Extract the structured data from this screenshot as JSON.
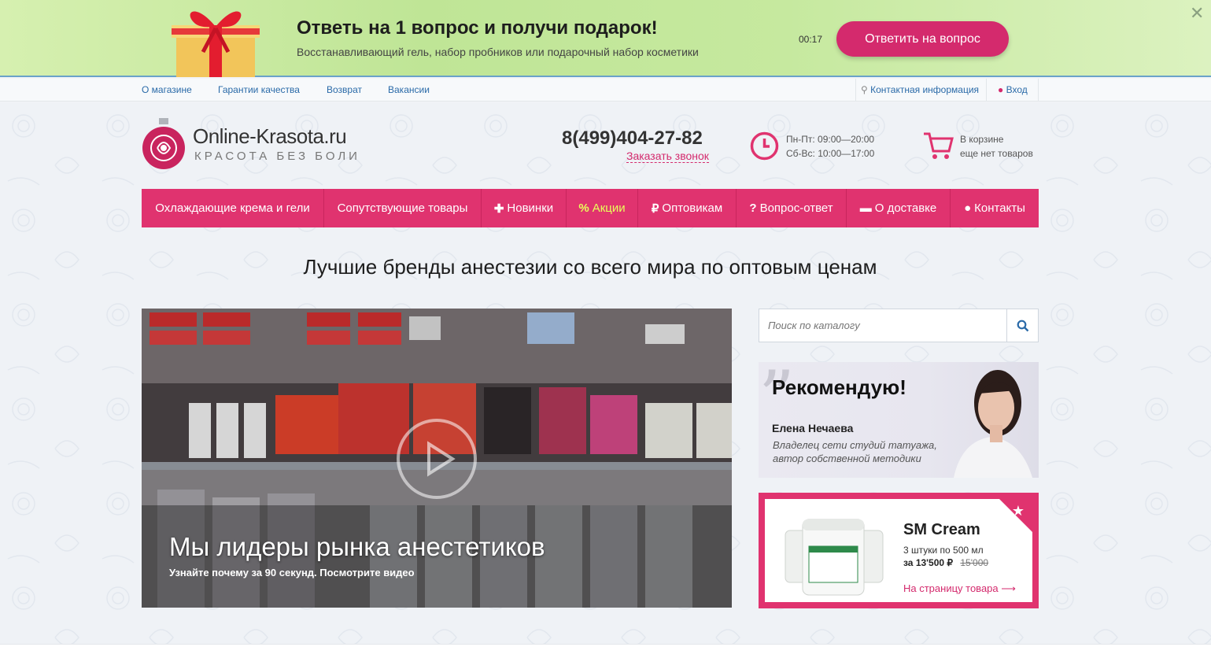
{
  "promo": {
    "title": "Ответь на 1 вопрос и получи подарок!",
    "subtitle": "Восстанавливающий гель, набор пробников или подарочный набор косметики",
    "timer": "00:17",
    "button": "Ответить на вопрос",
    "close": "✕"
  },
  "toplinks": [
    "О магазине",
    "Гарантии качества",
    "Возврат",
    "Вакансии"
  ],
  "contact_info": "Контактная информация",
  "login": "Вход",
  "logo": {
    "name": "Online-Krasota.ru",
    "tagline": "КРАСОТА БЕЗ БОЛИ"
  },
  "phone": "8(499)404-27-82",
  "callback": "Заказать звонок",
  "hours": {
    "weekdays": "Пн-Пт: 09:00—20:00",
    "weekend": "Сб-Вс: 10:00—17:00"
  },
  "cart": {
    "line1": "В корзине",
    "line2": "еще нет товаров"
  },
  "nav": [
    {
      "label": "Охлаждающие крема и гели",
      "icon": ""
    },
    {
      "label": "Сопутствующие товары",
      "icon": ""
    },
    {
      "label": "Новинки",
      "icon": "✚"
    },
    {
      "label": "Акции",
      "icon": "%"
    },
    {
      "label": "Оптовикам",
      "icon": "₽"
    },
    {
      "label": "Вопрос-ответ",
      "icon": "?"
    },
    {
      "label": "О доставке",
      "icon": "▬"
    },
    {
      "label": "Контакты",
      "icon": "●"
    }
  ],
  "headline": "Лучшие бренды анестезии со всего мира по оптовым ценам",
  "video": {
    "title": "Мы лидеры рынка анестетиков",
    "subtitle": "Узнайте почему за 90 секунд. Посмотрите видео"
  },
  "search": {
    "placeholder": "Поиск по каталогу"
  },
  "recommend": {
    "title": "Рекомендую!",
    "name": "Елена Нечаева",
    "desc1": "Владелец сети студий татуажа,",
    "desc2": "автор собственной методики"
  },
  "product": {
    "name": "SM Cream",
    "desc": "3 штуки по 500 мл",
    "price_prefix": "за",
    "price": "13'500 ₽",
    "old_price": "15'000",
    "link": "На страницу товара ⟶"
  },
  "colors": {
    "brand": "#e0336f",
    "link": "#2a6aa8",
    "promo_btn": "#d42a6d"
  }
}
